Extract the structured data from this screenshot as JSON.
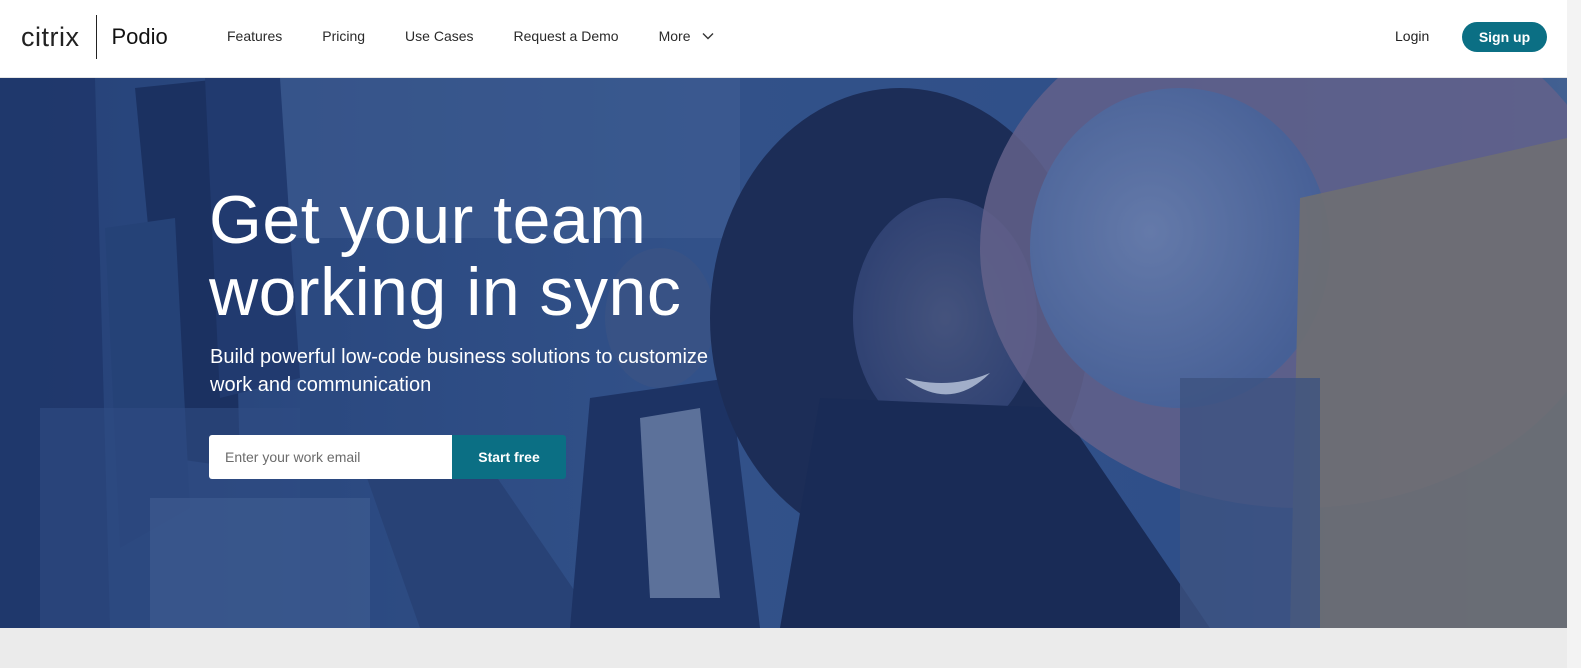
{
  "brand": {
    "company": "citrix",
    "product": "Podio"
  },
  "nav": {
    "items": [
      {
        "label": "Features"
      },
      {
        "label": "Pricing"
      },
      {
        "label": "Use Cases"
      },
      {
        "label": "Request a Demo"
      }
    ],
    "more_label": "More"
  },
  "account": {
    "login_label": "Login",
    "signup_label": "Sign up"
  },
  "hero": {
    "title_line1": "Get your team",
    "title_line2": "working in sync",
    "subtitle_line1": "Build powerful low-code business solutions to customize",
    "subtitle_line2": "work and communication",
    "email_placeholder": "Enter your work email",
    "cta_label": "Start free"
  },
  "colors": {
    "accent": "#0b6f84",
    "hero_tint": "#2f4f86"
  },
  "icons": {
    "more": "chevron-down-icon"
  }
}
